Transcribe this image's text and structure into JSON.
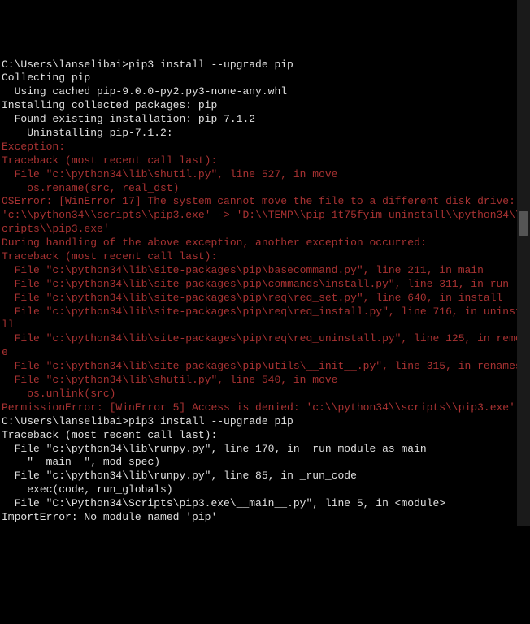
{
  "lines": [
    {
      "cls": "normal",
      "text": "C:\\Users\\lanselibai>pip3 install --upgrade pip"
    },
    {
      "cls": "normal",
      "text": "Collecting pip"
    },
    {
      "cls": "normal",
      "text": "  Using cached pip-9.0.0-py2.py3-none-any.whl"
    },
    {
      "cls": "normal",
      "text": "Installing collected packages: pip"
    },
    {
      "cls": "normal",
      "text": "  Found existing installation: pip 7.1.2"
    },
    {
      "cls": "normal",
      "text": "    Uninstalling pip-7.1.2:"
    },
    {
      "cls": "error",
      "text": "Exception:"
    },
    {
      "cls": "error",
      "text": "Traceback (most recent call last):"
    },
    {
      "cls": "error",
      "text": "  File \"c:\\python34\\lib\\shutil.py\", line 527, in move"
    },
    {
      "cls": "error",
      "text": "    os.rename(src, real_dst)"
    },
    {
      "cls": "error",
      "text": "OSError: [WinError 17] The system cannot move the file to a different disk drive: 'c:\\\\python34\\\\scripts\\\\pip3.exe' -> 'D:\\\\TEMP\\\\pip-1t75fyim-uninstall\\\\python34\\\\scripts\\\\pip3.exe'"
    },
    {
      "cls": "error",
      "text": ""
    },
    {
      "cls": "error",
      "text": "During handling of the above exception, another exception occurred:"
    },
    {
      "cls": "error",
      "text": ""
    },
    {
      "cls": "error",
      "text": "Traceback (most recent call last):"
    },
    {
      "cls": "error",
      "text": "  File \"c:\\python34\\lib\\site-packages\\pip\\basecommand.py\", line 211, in main"
    },
    {
      "cls": "error",
      "text": "  File \"c:\\python34\\lib\\site-packages\\pip\\commands\\install.py\", line 311, in run"
    },
    {
      "cls": "error",
      "text": ""
    },
    {
      "cls": "error",
      "text": "  File \"c:\\python34\\lib\\site-packages\\pip\\req\\req_set.py\", line 640, in install"
    },
    {
      "cls": "error",
      "text": "  File \"c:\\python34\\lib\\site-packages\\pip\\req\\req_install.py\", line 716, in uninstall"
    },
    {
      "cls": "error",
      "text": "  File \"c:\\python34\\lib\\site-packages\\pip\\req\\req_uninstall.py\", line 125, in remove"
    },
    {
      "cls": "error",
      "text": "  File \"c:\\python34\\lib\\site-packages\\pip\\utils\\__init__.py\", line 315, in renames"
    },
    {
      "cls": "error",
      "text": "  File \"c:\\python34\\lib\\shutil.py\", line 540, in move"
    },
    {
      "cls": "error",
      "text": "    os.unlink(src)"
    },
    {
      "cls": "error",
      "text": "PermissionError: [WinError 5] Access is denied: 'c:\\\\python34\\\\scripts\\\\pip3.exe'"
    },
    {
      "cls": "normal",
      "text": ""
    },
    {
      "cls": "normal",
      "text": "C:\\Users\\lanselibai>pip3 install --upgrade pip"
    },
    {
      "cls": "normal",
      "text": "Traceback (most recent call last):"
    },
    {
      "cls": "normal",
      "text": "  File \"c:\\python34\\lib\\runpy.py\", line 170, in _run_module_as_main"
    },
    {
      "cls": "normal",
      "text": "    \"__main__\", mod_spec)"
    },
    {
      "cls": "normal",
      "text": "  File \"c:\\python34\\lib\\runpy.py\", line 85, in _run_code"
    },
    {
      "cls": "normal",
      "text": "    exec(code, run_globals)"
    },
    {
      "cls": "normal",
      "text": "  File \"C:\\Python34\\Scripts\\pip3.exe\\__main__.py\", line 5, in <module>"
    },
    {
      "cls": "normal",
      "text": "ImportError: No module named 'pip'"
    },
    {
      "cls": "normal",
      "text": ""
    }
  ]
}
